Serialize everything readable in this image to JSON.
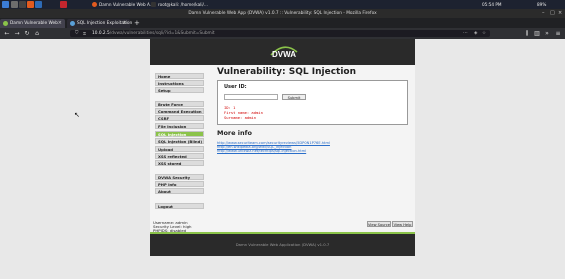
{
  "taskbar": {
    "window_1": "Damn Vulnerable Web A...",
    "window_2": "root@kali: /home/kali/...",
    "clock": "05:54 PM",
    "battery": "89%"
  },
  "window": {
    "title": "Damn Vulnerable Web App (DVWA) v1.0.7 :: Vulnerability: SQL Injection - Mozilla Firefox"
  },
  "tabs": [
    {
      "label": "Damn Vulnerable Web",
      "active": true
    },
    {
      "label": "SQL Injection Exploitation",
      "active": false
    }
  ],
  "nav": {
    "url_host": "10.0.2.5",
    "url_path": "/dvwa/vulnerabilities/sqli/?id=1&Submit=Submit"
  },
  "dvwa": {
    "logo": "DVWA",
    "title": "Vulnerability: SQL Injection",
    "form": {
      "label": "User ID:",
      "input_value": "",
      "submit": "Submit"
    },
    "result": {
      "id": "ID: 1",
      "first": "First name: admin",
      "surname": "Surname: admin"
    },
    "more_info": "More info",
    "links": [
      "http://www.securiteam.com/securityreviews/5DP0N1P76E.html",
      "http://en.wikipedia.org/wiki/SQL_injection",
      "http://www.unixwiz.net/techtips/sql-injection.html"
    ],
    "menu": [
      {
        "label": "Home",
        "active": false
      },
      {
        "label": "Instructions",
        "active": false
      },
      {
        "label": "Setup",
        "active": false
      },
      {
        "label": "Brute Force",
        "active": false
      },
      {
        "label": "Command Execution",
        "active": false
      },
      {
        "label": "CSRF",
        "active": false
      },
      {
        "label": "File Inclusion",
        "active": false
      },
      {
        "label": "SQL Injection",
        "active": true
      },
      {
        "label": "SQL Injection (Blind)",
        "active": false
      },
      {
        "label": "Upload",
        "active": false
      },
      {
        "label": "XSS reflected",
        "active": false
      },
      {
        "label": "XSS stored",
        "active": false
      },
      {
        "label": "DVWA Security",
        "active": false
      },
      {
        "label": "PHP Info",
        "active": false
      },
      {
        "label": "About",
        "active": false
      },
      {
        "label": "Logout",
        "active": false
      }
    ],
    "info": {
      "username": "Username: admin",
      "security": "Security Level: high",
      "phpids": "PHPIDS: disabled"
    },
    "buttons": {
      "view_source": "View Source",
      "view_help": "View Help"
    },
    "footer": "Damn Vulnerable Web Application (DVWA) v1.0.7"
  },
  "colors": {
    "accent": "#8bc34a",
    "header_bg": "#2a2a2a",
    "result_text": "#d00000",
    "link": "#2a6ec9"
  }
}
